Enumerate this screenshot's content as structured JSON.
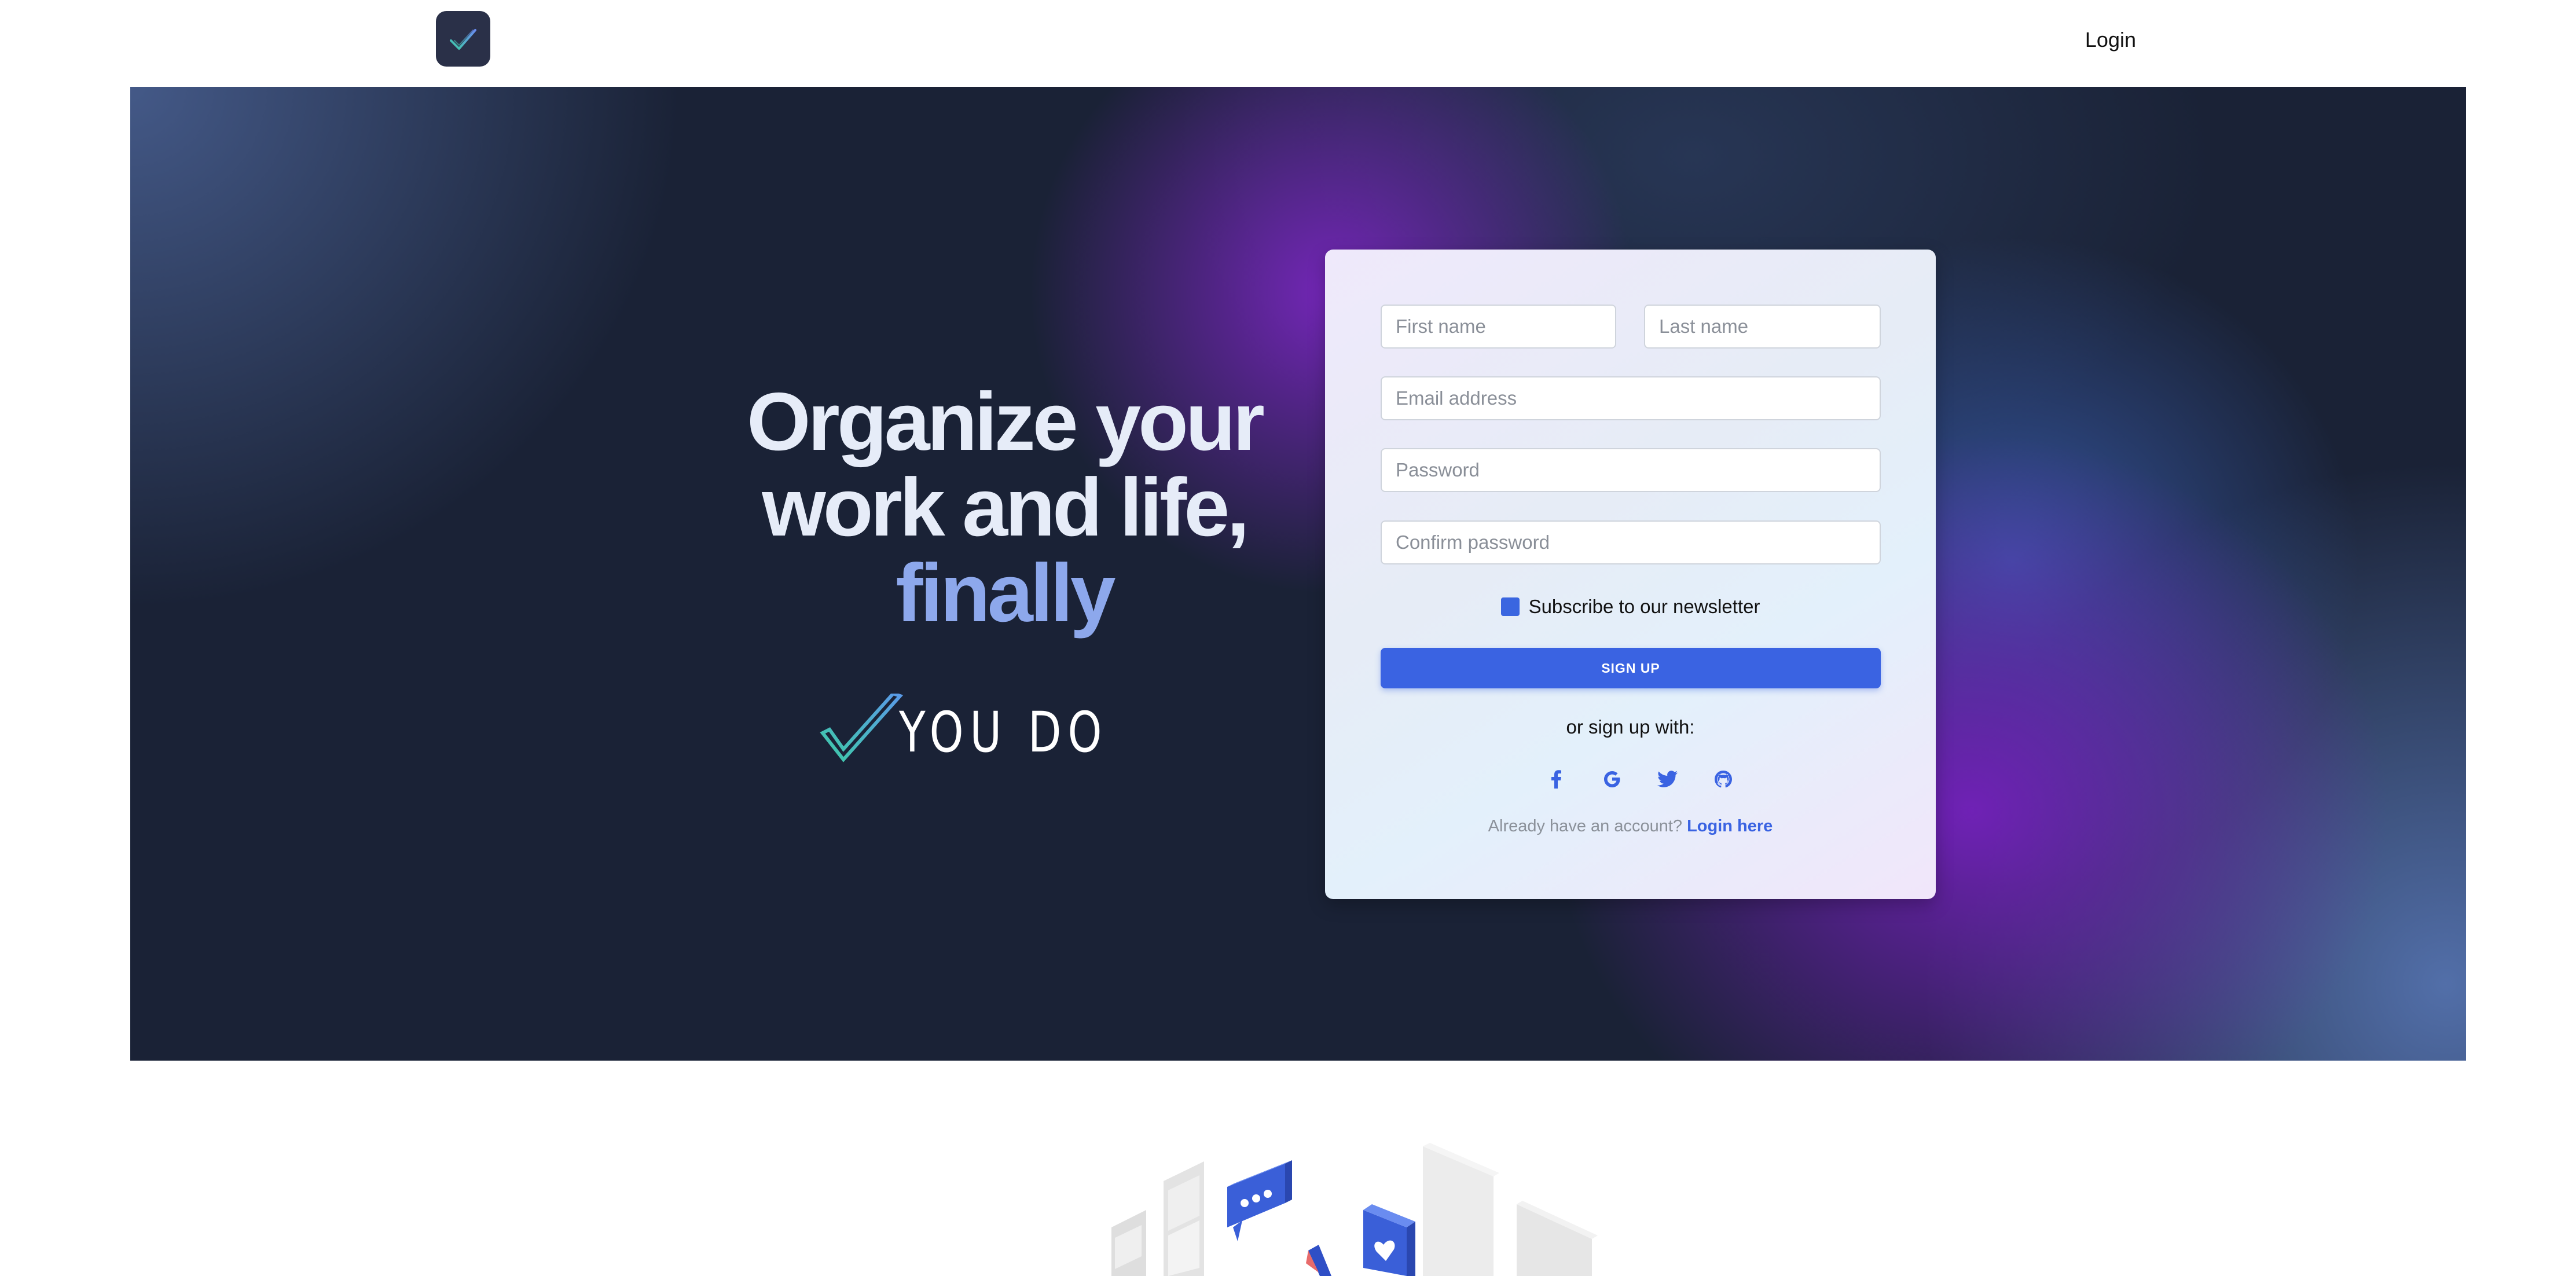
{
  "nav": {
    "login_label": "Login"
  },
  "hero": {
    "headline_line1": "Organize your",
    "headline_line2": "work and life,",
    "headline_accent": "finally",
    "brand_name": "YOU DO"
  },
  "signup_form": {
    "first_name_placeholder": "First name",
    "last_name_placeholder": "Last name",
    "email_placeholder": "Email address",
    "password_placeholder": "Password",
    "confirm_password_placeholder": "Confirm password",
    "newsletter_label": "Subscribe to our newsletter",
    "newsletter_checked": true,
    "signup_button_label": "SIGN UP",
    "alt_signup_text": "or sign up with:",
    "social_icons": [
      "facebook-icon",
      "google-icon",
      "twitter-icon",
      "github-icon"
    ],
    "already_account_text": "Already have an account?",
    "login_here_label": "Login here"
  },
  "colors": {
    "accent_blue": "#3a63e2",
    "headline_accent": "#8da8ec",
    "brand_check": "#3ec9a7",
    "hero_base": "#1a2236",
    "logo_bg": "#2a3048"
  }
}
